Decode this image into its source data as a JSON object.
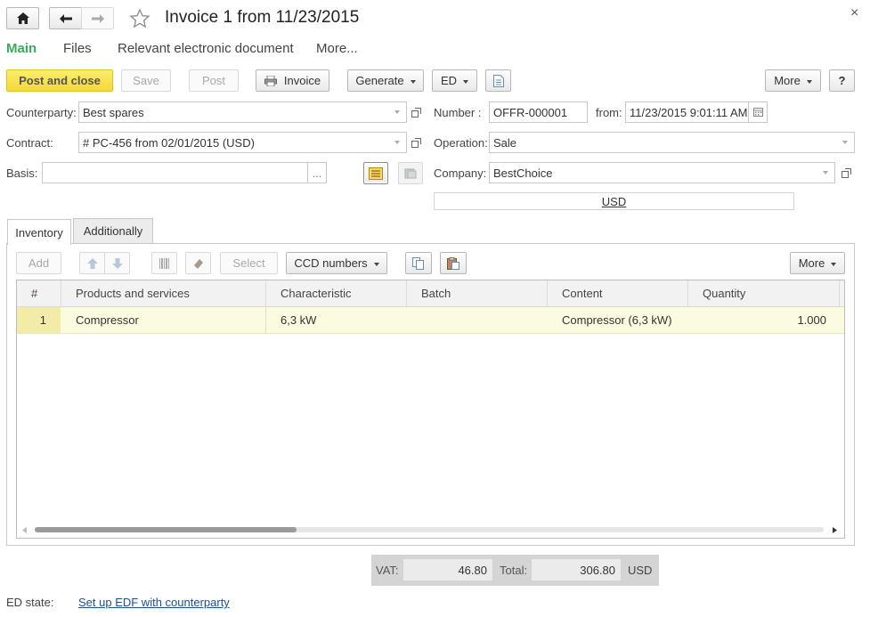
{
  "window": {
    "title": "Invoice 1 from 11/23/2015",
    "close_glyph": "×"
  },
  "nav_tabs": [
    "Main",
    "Files",
    "Relevant electronic document",
    "More..."
  ],
  "toolbar": {
    "post_and_close": "Post and close",
    "save": "Save",
    "post": "Post",
    "invoice": "Invoice",
    "generate": "Generate",
    "ed": "ED",
    "more": "More",
    "help": "?"
  },
  "form": {
    "counterparty_label": "Counterparty:",
    "counterparty_value": "Best spares",
    "contract_label": "Contract:",
    "contract_value": "# PC-456 from 02/01/2015 (USD)",
    "basis_label": "Basis:",
    "basis_value": "",
    "basis_ellipsis": "...",
    "number_label": "Number :",
    "number_value": "OFFR-000001",
    "from_label": "from:",
    "from_value": "11/23/2015  9:01:11 AM",
    "operation_label": "Operation:",
    "operation_value": "Sale",
    "company_label": "Company:",
    "company_value": "BestChoice",
    "currency_link": "USD"
  },
  "section_tabs": [
    "Inventory",
    "Additionally"
  ],
  "table_toolbar": {
    "add": "Add",
    "select": "Select",
    "ccd_numbers": "CCD numbers",
    "more": "More"
  },
  "table": {
    "columns": [
      "#",
      "Products and services",
      "Characteristic",
      "Batch",
      "Content",
      "Quantity"
    ],
    "rows": [
      {
        "num": "1",
        "product": "Compressor",
        "characteristic": "6,3 kW",
        "batch": "",
        "content": "Compressor (6,3 kW)",
        "quantity": "1.000"
      }
    ]
  },
  "totals": {
    "vat_label": "VAT:",
    "vat_value": "46.80",
    "total_label": "Total:",
    "total_value": "306.80",
    "currency": "USD"
  },
  "footer": {
    "ed_state_label": "ED state:",
    "ed_state_link": "Set up EDF with counterparty"
  },
  "colors": {
    "accent_green": "#3aa95b",
    "primary_button": "#f4d833",
    "row_highlight": "#fbfbdf",
    "link_blue": "#1f4e8c"
  },
  "icons": [
    "home-icon",
    "arrow-left-icon",
    "arrow-right-icon",
    "star-icon",
    "close-icon",
    "printer-icon",
    "document-icon",
    "open-form-icon",
    "calendar-icon",
    "structure-icon",
    "fill-icon",
    "arrow-up-icon",
    "arrow-down-icon",
    "barcode-icon",
    "eraser-icon",
    "copy-icon",
    "paste-icon"
  ]
}
